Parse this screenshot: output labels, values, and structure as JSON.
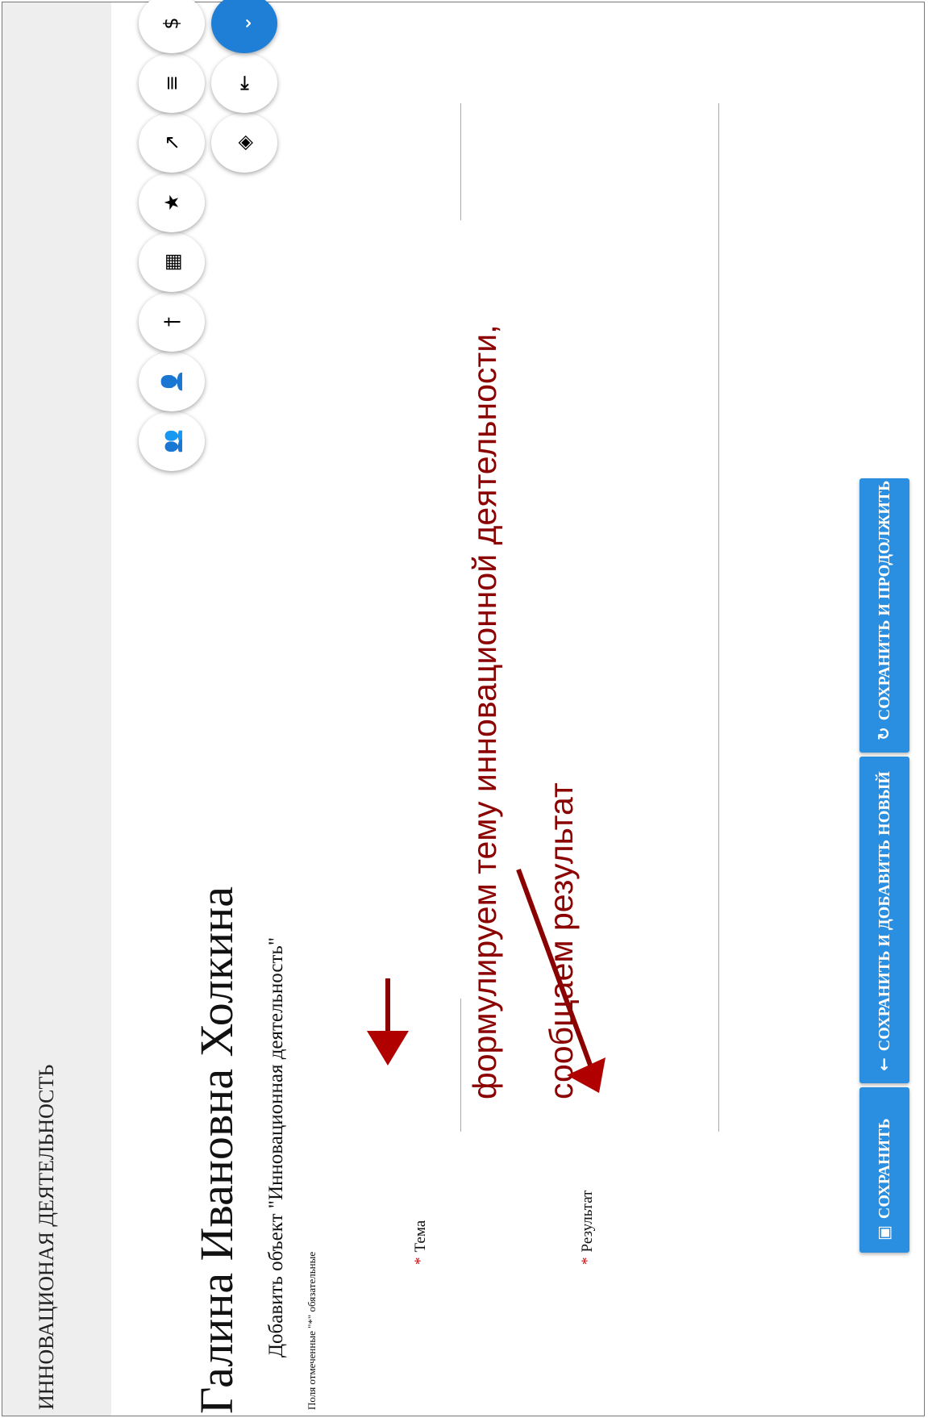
{
  "section_title": "ИННОВАЦИОНАЯ ДЕЯТЕЛЬНОСТЬ",
  "page_title": "Галина Ивановна Холкина",
  "subtitle": "Добавить объект \"Инновационная деятельность\"",
  "required_note": "Поля отмеченные \"*\" обязательные",
  "fields": {
    "tema_label": "Тема",
    "result_label": "Результат",
    "required_mark": "*"
  },
  "annotations": {
    "line1": "формулируем тему инновационной деятельности,",
    "line2": "сообщаем результат"
  },
  "toolbar": {
    "icons": [
      {
        "name": "users-icon",
        "glyph": "👥"
      },
      {
        "name": "person-icon",
        "glyph": "👤"
      },
      {
        "name": "pin-icon",
        "glyph": "†"
      },
      {
        "name": "calendar-icon",
        "glyph": "▦"
      },
      {
        "name": "star-icon",
        "glyph": "★"
      },
      {
        "name": "chart-icon",
        "glyph": "↗"
      },
      {
        "name": "list-icon",
        "glyph": "≡"
      },
      {
        "name": "dollar-icon",
        "glyph": "$"
      },
      {
        "name": "box-icon",
        "glyph": "◈"
      },
      {
        "name": "outdent-icon",
        "glyph": "⇤"
      },
      {
        "name": "chevron-down-icon",
        "glyph": "⌄"
      }
    ]
  },
  "buttons": {
    "save": "СОХРАНИТЬ",
    "save_add_new": "СОХРАНИТЬ И ДОБАВИТЬ НОВЫЙ",
    "save_continue": "СОХРАНИТЬ И ПРОДОЛЖИТЬ"
  },
  "colors": {
    "accent": "#2a8fe0",
    "annotation": "#8b0000",
    "required": "#cc0000"
  }
}
